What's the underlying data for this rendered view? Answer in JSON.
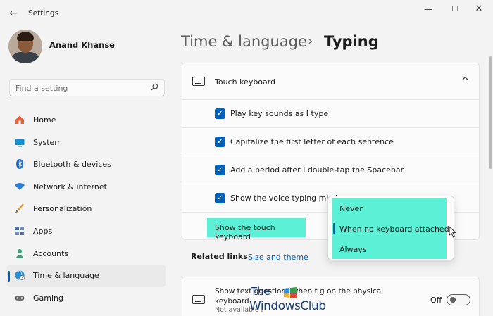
{
  "window": {
    "title": "Settings",
    "back_icon": "back-arrow-icon",
    "min_glyph": "—",
    "max_glyph": "☐",
    "close_glyph": "✕"
  },
  "user": {
    "name": "Anand Khanse"
  },
  "search": {
    "placeholder": "Find a setting"
  },
  "nav": {
    "items": [
      {
        "label": "Home",
        "icon": "home-icon",
        "color": "#e8643c"
      },
      {
        "label": "System",
        "icon": "system-icon",
        "color": "#0f8fd6"
      },
      {
        "label": "Bluetooth & devices",
        "icon": "bluetooth-icon",
        "color": "#1f6fd1"
      },
      {
        "label": "Network & internet",
        "icon": "network-icon",
        "color": "#2b7fd4"
      },
      {
        "label": "Personalization",
        "icon": "brush-icon",
        "color": "#e2962f"
      },
      {
        "label": "Apps",
        "icon": "apps-icon",
        "color": "#4a6fa6"
      },
      {
        "label": "Accounts",
        "icon": "accounts-icon",
        "color": "#2fa374"
      },
      {
        "label": "Time & language",
        "icon": "globe-clock-icon",
        "color": "#2a8fd8",
        "active": true
      },
      {
        "label": "Gaming",
        "icon": "gaming-icon",
        "color": "#6e6e6e"
      }
    ]
  },
  "header": {
    "parent": "Time & language",
    "separator": "›",
    "current": "Typing"
  },
  "touch_keyboard": {
    "title": "Touch keyboard",
    "options": [
      {
        "label": "Play key sounds as I type",
        "checked": true
      },
      {
        "label": "Capitalize the first letter of each sentence",
        "checked": true
      },
      {
        "label": "Add a period after I double-tap the Spacebar",
        "checked": true
      },
      {
        "label": "Show the voice typing mic bu",
        "checked": true
      }
    ],
    "show_label": "Show the touch keyboard"
  },
  "dropdown": {
    "options": [
      "Never",
      "When no keyboard attached",
      "Always"
    ],
    "selected": "When no keyboard attached"
  },
  "related": {
    "label": "Related links",
    "link": "Size and theme"
  },
  "text_suggestions": {
    "title": "Show text   ggestions when t   g on the physical keyboard",
    "subtitle": "Not available i",
    "state": "Off"
  },
  "watermark": {
    "line1": "The",
    "line2": "WindowsClub"
  },
  "colors": {
    "accent": "#005fb8",
    "highlight": "#5cf0d6"
  }
}
